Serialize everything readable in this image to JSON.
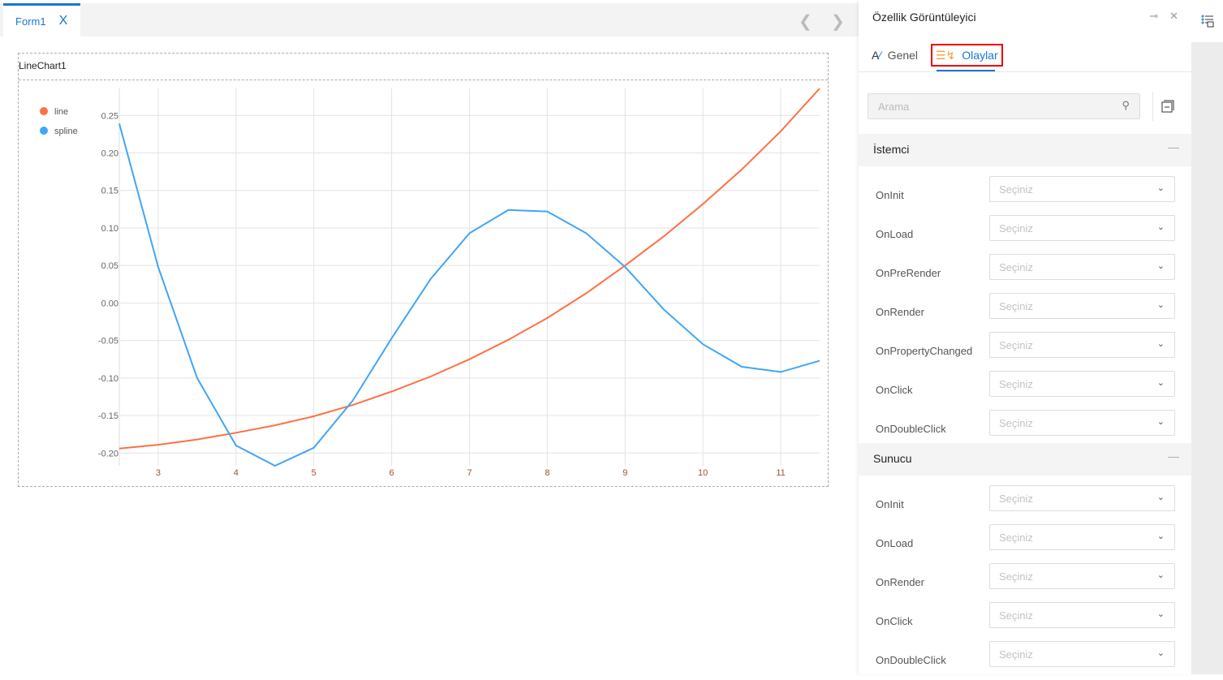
{
  "tabs": [
    {
      "label": "Form1",
      "close": "X"
    }
  ],
  "chart_widget": {
    "title": "LineChart1"
  },
  "chart_data": {
    "type": "line",
    "title": "",
    "legend_position": "top-left",
    "x_ticks": [
      3,
      4,
      5,
      6,
      7,
      8,
      9,
      10,
      11
    ],
    "y_ticks": [
      "0.25",
      "0.20",
      "0.15",
      "0.10",
      "0.05",
      "0.00",
      "-0.05",
      "-0.10",
      "-0.15",
      "-0.20"
    ],
    "xlim": [
      2.5,
      11.5
    ],
    "ylim": [
      -0.217,
      0.286
    ],
    "grid": true,
    "x": [
      2.5,
      3,
      3.5,
      4,
      4.5,
      5,
      5.5,
      6,
      6.5,
      7,
      7.5,
      8,
      8.5,
      9,
      9.5,
      10,
      10.5,
      11,
      11.5
    ],
    "series": [
      {
        "name": "line",
        "color": "#ff7043",
        "values": [
          -0.194,
          -0.189,
          -0.182,
          -0.173,
          -0.163,
          -0.151,
          -0.136,
          -0.118,
          -0.098,
          -0.075,
          -0.049,
          -0.02,
          0.013,
          0.05,
          0.089,
          0.132,
          0.178,
          0.229,
          0.286
        ]
      },
      {
        "name": "spline",
        "color": "#42a5f5",
        "values": [
          0.239,
          0.048,
          -0.1,
          -0.19,
          -0.217,
          -0.193,
          -0.13,
          -0.047,
          0.032,
          0.093,
          0.124,
          0.122,
          0.093,
          0.048,
          -0.009,
          -0.055,
          -0.085,
          -0.092,
          -0.077
        ]
      }
    ]
  },
  "panel": {
    "title": "Özellik Görüntüleyici",
    "tabs": {
      "general": "Genel",
      "events": "Olaylar"
    },
    "search_placeholder": "Arama",
    "sections": [
      {
        "title": "İstemci",
        "rows": [
          {
            "label": "OnInit",
            "value": "Seçiniz"
          },
          {
            "label": "OnLoad",
            "value": "Seçiniz"
          },
          {
            "label": "OnPreRender",
            "value": "Seçiniz"
          },
          {
            "label": "OnRender",
            "value": "Seçiniz"
          },
          {
            "label": "OnPropertyChanged",
            "value": "Seçiniz"
          },
          {
            "label": "OnClick",
            "value": "Seçiniz"
          },
          {
            "label": "OnDoubleClick",
            "value": "Seçiniz"
          }
        ]
      },
      {
        "title": "Sunucu",
        "rows": [
          {
            "label": "OnInit",
            "value": "Seçiniz"
          },
          {
            "label": "OnLoad",
            "value": "Seçiniz"
          },
          {
            "label": "OnRender",
            "value": "Seçiniz"
          },
          {
            "label": "OnClick",
            "value": "Seçiniz"
          },
          {
            "label": "OnDoubleClick",
            "value": "Seçiniz"
          }
        ]
      }
    ]
  }
}
